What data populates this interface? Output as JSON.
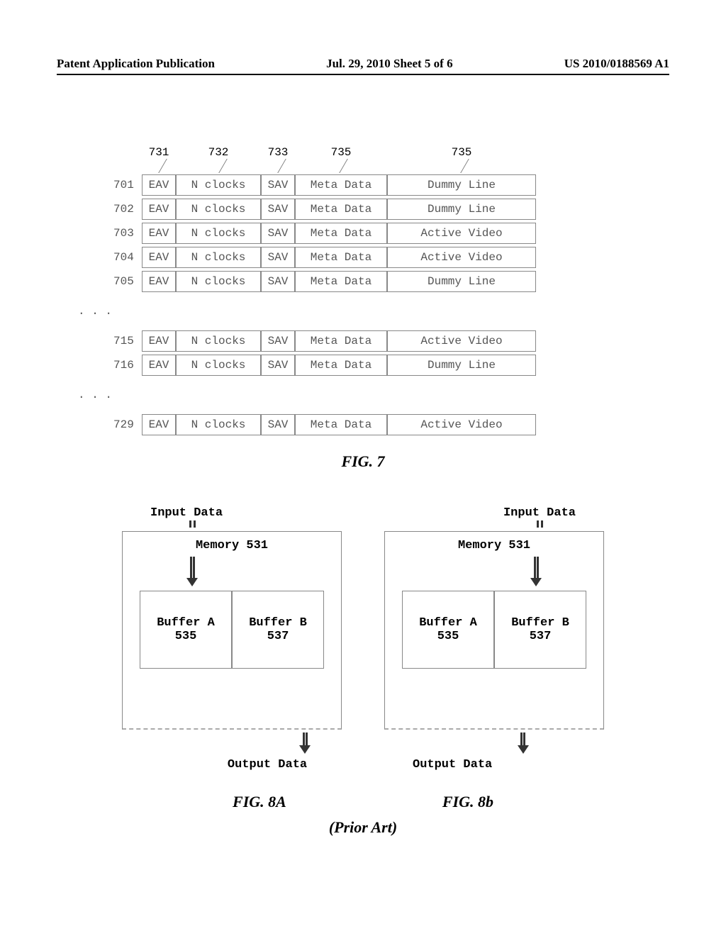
{
  "header": {
    "left": "Patent Application Publication",
    "center": "Jul. 29, 2010  Sheet 5 of 6",
    "right": "US 2010/0188569 A1"
  },
  "fig7": {
    "columns": {
      "c1": "731",
      "c2": "732",
      "c3": "733",
      "c4": "735",
      "c5": "735"
    },
    "cell_labels": {
      "eav": "EAV",
      "nclocks": "N clocks",
      "sav": "SAV",
      "meta": "Meta Data"
    },
    "rows1": [
      {
        "num": "701",
        "last": "Dummy Line"
      },
      {
        "num": "702",
        "last": "Dummy Line"
      },
      {
        "num": "703",
        "last": "Active Video"
      },
      {
        "num": "704",
        "last": "Active Video"
      },
      {
        "num": "705",
        "last": "Dummy Line"
      }
    ],
    "ellipsis": ". . .",
    "rows2": [
      {
        "num": "715",
        "last": "Active Video"
      },
      {
        "num": "716",
        "last": "Dummy Line"
      }
    ],
    "rows3": [
      {
        "num": "729",
        "last": "Active Video"
      }
    ],
    "caption": "FIG. 7"
  },
  "fig8": {
    "input_label": "Input Data",
    "memory_label": "Memory 531",
    "buffer_a": {
      "line1": "Buffer A",
      "line2": "535"
    },
    "buffer_b": {
      "line1": "Buffer B",
      "line2": "537"
    },
    "output_label": "Output Data",
    "caption_a": "FIG. 8A",
    "caption_b": "FIG. 8b",
    "prior_art": "(Prior Art)"
  }
}
